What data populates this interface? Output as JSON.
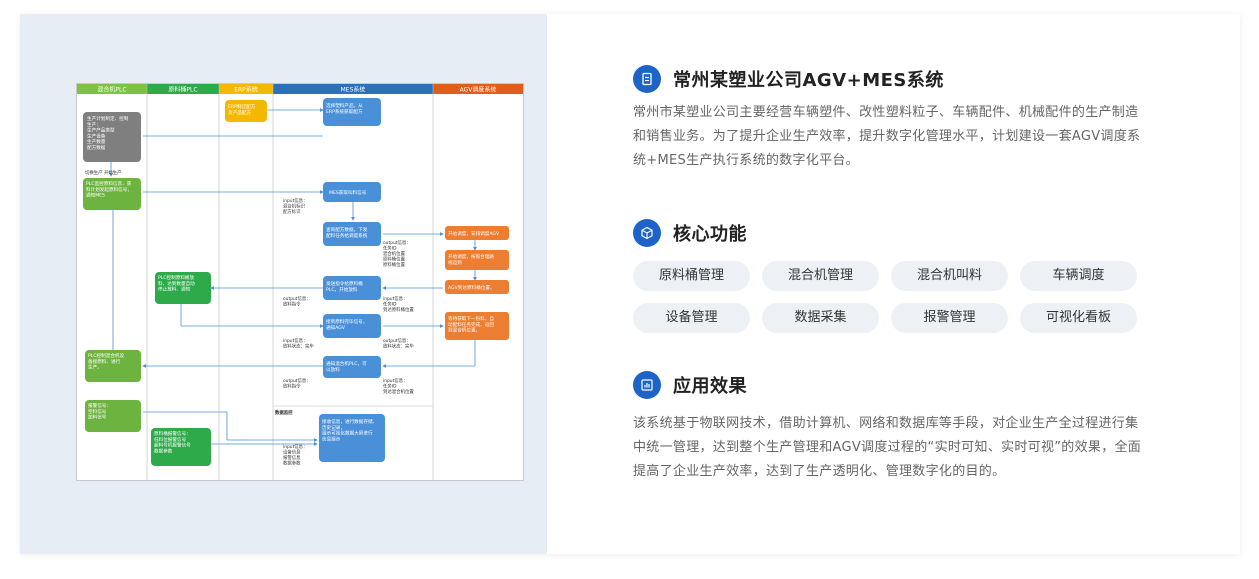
{
  "project": {
    "title": "常州某塑业公司AGV+MES系统",
    "intro": "常州市某塑业公司主要经营车辆塑件、改性塑料粒子、车辆配件、机械配件的生产制造和销售业务。为了提升企业生产效率，提升数字化管理水平，计划建设一套AGV调度系统+MES生产执行系统的数字化平台。"
  },
  "core": {
    "title": "核心功能",
    "tags": [
      "原料桶管理",
      "混合机管理",
      "混合机叫料",
      "车辆调度",
      "设备管理",
      "数据采集",
      "报警管理",
      "可视化看板"
    ]
  },
  "effect": {
    "title": "应用效果",
    "text": "该系统基于物联网技术，借助计算机、网络和数据库等手段，对企业生产全过程进行集中统一管理，达到整个生产管理和AGV调度过程的“实时可知、实时可视”的效果，全面提高了企业生产效率，达到了生产透明化、管理数字化的目的。"
  },
  "flow": {
    "lanes": [
      "混合机PLC",
      "原料桶PLC",
      "ERP系统",
      "MES系统",
      "AGV调度系统"
    ],
    "lane_colors": [
      "#6db33f",
      "#2eaa4a",
      "#f5b800",
      "#2e6fb5",
      "#e35d1a"
    ],
    "boxes": {
      "gray": "生产计划制定、控制\n生产：\n生产产品类型\n生产设备\n生产数量\n配方数据",
      "plc_mix_1": "PLC监控原料信息、获\n料计划发起原料信号，\n通知MES",
      "plc_mix_2": "PLC控制混合机设\n备接原料、进行\n生产。",
      "alarm_mix": "报警信号：\n空料信号\n加料信号",
      "plc_bucket_1": "PLC控制原料桶放\n料、达到数量自动\n停止放料、通知",
      "alarm_bucket": "原料桶报警信号：\n低料位报警信号\n超料号机报警信号\n数据参数",
      "erp": "ERP制订配方\n及产品配方",
      "mes_1": "选择塑料产品，从\nERP系统获取配方",
      "mes_2": "MES获取叫料信号",
      "mes_3": "查询配方数据，下发\n配料任务给调度系统",
      "mes_4": "发送指令给原料桶\nPLC，开始放料",
      "mes_5": "接到原料完毕信号，\n通知AGV",
      "mes_6": "通知混合机PLC，可\n以放料",
      "mes_7": "接收信息，进行数据存储、\n历史记录，\n展示可视化数据大屏进行\n信息展示",
      "agv_1": "开始调度，安排调度AGV",
      "agv_2": "开始调度，按照合理路\n线运到",
      "agv_3": "AGV到达原料桶位置。",
      "agv_4": "等待获取下一份料，自\n动配料任务完成，返回\n到混合机位置。",
      "stop_start": "切换生产    开始生产",
      "input_1": "input信息：\n混合机标识\n配方标识",
      "output_1": "output信息：\n任务ID\n混合机位置\n原料桶位置\n原料桶位置",
      "output_2": "output信息：\n放料指令",
      "input_2": "input信息：\n任务ID\n到达原料桶位置",
      "input_3": "input信息：\n放料状态：完毕",
      "output_3": "output信息：\n放料状态：完毕",
      "output_4": "output信息：\n放料指令",
      "input_4": "input信息：\n任务ID\n到达混合机位置",
      "data_monitor": "数据监控",
      "input_5": "input信息：\n设备信息\n报警信息\n数据参数"
    }
  }
}
